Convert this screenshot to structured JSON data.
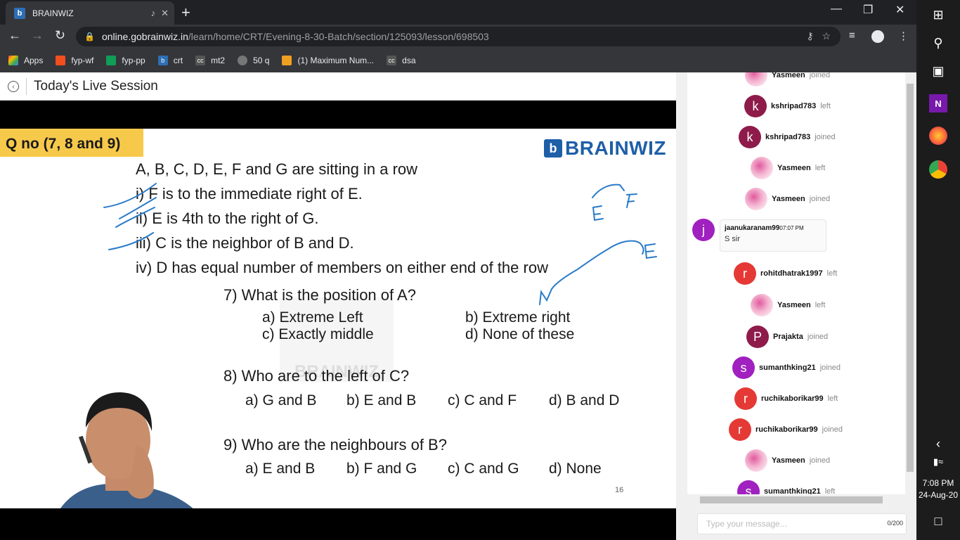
{
  "browser": {
    "tab": {
      "title": "BRAINWIZ",
      "favicon_letter": "b"
    },
    "omnibox": {
      "host": "online.gobrainwiz.in",
      "path": "/learn/home/CRT/Evening-8-30-Batch/section/125093/lesson/698503"
    },
    "bookmarks": [
      {
        "label": "Apps",
        "icon": "apps-grid-icon",
        "color": "#e8453c"
      },
      {
        "label": "fyp-wf",
        "icon": "figma-icon",
        "color": "#f24e1e"
      },
      {
        "label": "fyp-pp",
        "icon": "sheet-icon",
        "color": "#0f9d58"
      },
      {
        "label": "crt",
        "icon": "brainwiz-icon",
        "color": "#2d6fb5"
      },
      {
        "label": "mt2",
        "icon": "cc-icon",
        "color": "#555555"
      },
      {
        "label": "50 q",
        "icon": "globe-icon",
        "color": "#777777"
      },
      {
        "label": "(1) Maximum Num...",
        "icon": "leetcode-icon",
        "color": "#f0a020"
      },
      {
        "label": "dsa",
        "icon": "cc-icon",
        "color": "#555555"
      }
    ]
  },
  "page": {
    "title": "Today's Live Session"
  },
  "slide": {
    "badge": "Q no (7, 8 and 9)",
    "brand": "BRAINWIZ",
    "brand_icon": "b",
    "statement": "A, B, C, D, E, F and G are sitting in a row",
    "conditions": [
      "i)  F is to the immediate right of E.",
      "ii)  E is 4th to the right of G.",
      "iii) C is the neighbor of B and D.",
      "iv) D has equal number of members on either end of the row"
    ],
    "q7": {
      "question": "7) What is the position of A?",
      "a": "a)   Extreme Left",
      "b": "b) Extreme right",
      "c": "c)   Exactly middle",
      "d": "d) None of these"
    },
    "q8": {
      "question": "8) Who are to the left of C?",
      "a": "a) G and B",
      "b": "b) E and B",
      "c": "c) C and F",
      "d": "d) B and D"
    },
    "q9": {
      "question": "9) Who are the neighbours of B?",
      "a": "a) E and B",
      "b": "b) F and G",
      "c": "c) C and G",
      "d": "d) None"
    },
    "watermark": "BRAINWIZ",
    "slide_number": "16"
  },
  "chat": {
    "events": [
      {
        "user": "Yasmeen",
        "action": "joined",
        "avatar": "image"
      },
      {
        "user": "kshripad783",
        "action": "left",
        "avatar": "k",
        "color": "#8e1b4a"
      },
      {
        "user": "kshripad783",
        "action": "joined",
        "avatar": "k",
        "color": "#8e1b4a"
      },
      {
        "user": "Yasmeen",
        "action": "left",
        "avatar": "image"
      },
      {
        "user": "Yasmeen",
        "action": "joined",
        "avatar": "image"
      },
      {
        "user": "rohitdhatrak1997",
        "action": "left",
        "avatar": "r",
        "color": "#e53935"
      },
      {
        "user": "Yasmeen",
        "action": "left",
        "avatar": "image"
      },
      {
        "user": "Prajakta",
        "action": "joined",
        "avatar": "P",
        "color": "#8e1b4a"
      },
      {
        "user": "sumanthking21",
        "action": "joined",
        "avatar": "s",
        "color": "#a020c0"
      },
      {
        "user": "ruchikaborikar99",
        "action": "left",
        "avatar": "r",
        "color": "#e53935"
      },
      {
        "user": "ruchikaborikar99",
        "action": "joined",
        "avatar": "r",
        "color": "#e53935"
      },
      {
        "user": "Yasmeen",
        "action": "joined",
        "avatar": "image"
      },
      {
        "user": "sumanthking21",
        "action": "left",
        "avatar": "s",
        "color": "#a020c0"
      }
    ],
    "message": {
      "user": "jaanukaranam99",
      "time": "07:07 PM",
      "text": "S sir",
      "avatar": "j",
      "color": "#a020c0"
    },
    "input": {
      "placeholder": "Type your message...",
      "counter": "0/200"
    }
  },
  "taskbar": {
    "time": "7:08 PM",
    "date": "24-Aug-20"
  }
}
